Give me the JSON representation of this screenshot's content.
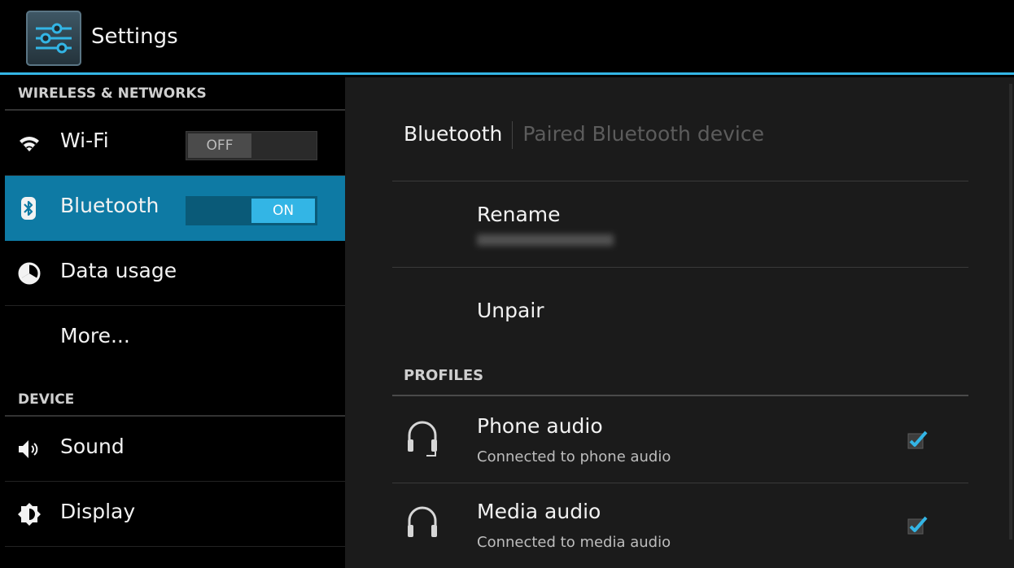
{
  "app": {
    "title": "Settings",
    "accent_color": "#33b5e5",
    "icon": "settings-sliders-icon"
  },
  "sidebar": {
    "sections": [
      {
        "header": "WIRELESS & NETWORKS",
        "items": [
          {
            "label": "Wi-Fi",
            "icon": "wifi-icon",
            "toggle": "OFF",
            "selected": false
          },
          {
            "label": "Bluetooth",
            "icon": "bluetooth-icon",
            "toggle": "ON",
            "selected": true
          },
          {
            "label": "Data usage",
            "icon": "data-usage-icon",
            "selected": false
          },
          {
            "label": "More...",
            "icon": null,
            "selected": false
          }
        ]
      },
      {
        "header": "DEVICE",
        "items": [
          {
            "label": "Sound",
            "icon": "speaker-icon",
            "selected": false
          },
          {
            "label": "Display",
            "icon": "brightness-icon",
            "selected": false
          }
        ]
      }
    ]
  },
  "detail": {
    "breadcrumb": {
      "main": "Bluetooth",
      "sub": "Paired Bluetooth device"
    },
    "rename": {
      "title": "Rename"
    },
    "unpair": {
      "title": "Unpair"
    },
    "profiles": {
      "header": "PROFILES",
      "items": [
        {
          "title": "Phone audio",
          "summary": "Connected to phone audio",
          "checked": true,
          "icon": "headset-mic-icon"
        },
        {
          "title": "Media audio",
          "summary": "Connected to media audio",
          "checked": true,
          "icon": "headphones-icon"
        }
      ]
    }
  }
}
